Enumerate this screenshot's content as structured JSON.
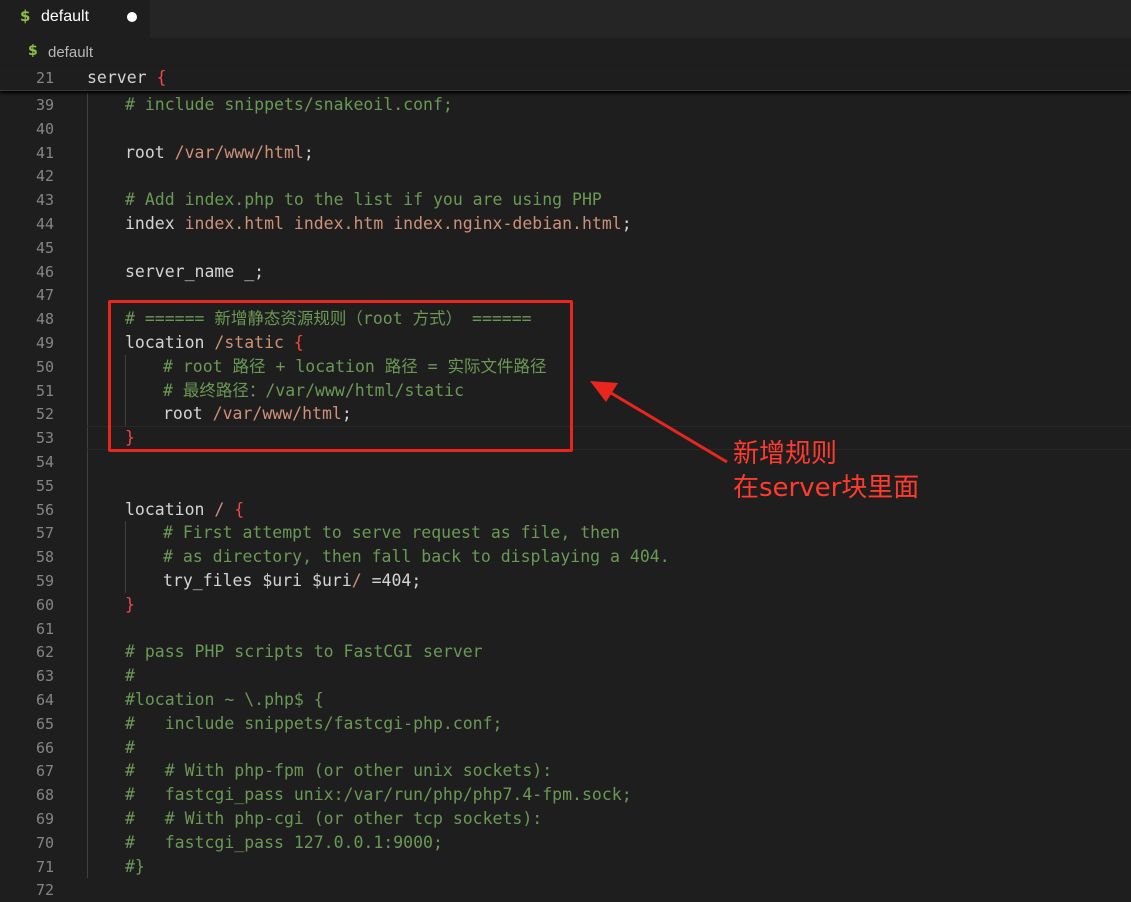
{
  "tab": {
    "icon": "dollar-file-icon",
    "label": "default",
    "dirty": true
  },
  "breadcrumb": {
    "icon": "dollar-file-icon",
    "label": "default"
  },
  "sticky_line": {
    "number": "21",
    "code": "server {"
  },
  "lines": [
    {
      "n": "39",
      "indent": 1,
      "parts": [
        [
          "cm",
          "# include snippets/snakeoil.conf;"
        ]
      ]
    },
    {
      "n": "40",
      "indent": 1,
      "parts": []
    },
    {
      "n": "41",
      "indent": 1,
      "parts": [
        [
          "plain",
          "root "
        ],
        [
          "vs",
          "/var/www/html"
        ],
        [
          "plain",
          ";"
        ]
      ]
    },
    {
      "n": "42",
      "indent": 1,
      "parts": []
    },
    {
      "n": "43",
      "indent": 1,
      "parts": [
        [
          "cm",
          "# Add index.php to the list if you are using PHP"
        ]
      ]
    },
    {
      "n": "44",
      "indent": 1,
      "parts": [
        [
          "plain",
          "index "
        ],
        [
          "vs",
          "index.html index.htm index.nginx-debian.html"
        ],
        [
          "plain",
          ";"
        ]
      ]
    },
    {
      "n": "45",
      "indent": 1,
      "parts": []
    },
    {
      "n": "46",
      "indent": 1,
      "parts": [
        [
          "plain",
          "server_name _;"
        ]
      ]
    },
    {
      "n": "47",
      "indent": 1,
      "parts": []
    },
    {
      "n": "48",
      "indent": 1,
      "parts": [
        [
          "cm",
          "# ====== 新增静态资源规则（root 方式） ======"
        ]
      ]
    },
    {
      "n": "49",
      "indent": 1,
      "parts": [
        [
          "plain",
          "location "
        ],
        [
          "vs",
          "/static "
        ],
        [
          "br",
          "{"
        ]
      ]
    },
    {
      "n": "50",
      "indent": 2,
      "parts": [
        [
          "cm",
          "# root 路径 + location 路径 = 实际文件路径"
        ]
      ]
    },
    {
      "n": "51",
      "indent": 2,
      "parts": [
        [
          "cm",
          "# 最终路径：/var/www/html/static"
        ]
      ]
    },
    {
      "n": "52",
      "indent": 2,
      "parts": [
        [
          "plain",
          "root "
        ],
        [
          "vs",
          "/var/www/html"
        ],
        [
          "plain",
          ";"
        ]
      ]
    },
    {
      "n": "53",
      "indent": 1,
      "parts": [
        [
          "br",
          "}"
        ]
      ]
    },
    {
      "n": "54",
      "indent": 1,
      "parts": []
    },
    {
      "n": "55",
      "indent": 1,
      "parts": []
    },
    {
      "n": "56",
      "indent": 1,
      "parts": [
        [
          "plain",
          "location "
        ],
        [
          "vs",
          "/ "
        ],
        [
          "br",
          "{"
        ]
      ]
    },
    {
      "n": "57",
      "indent": 2,
      "parts": [
        [
          "cm",
          "# First attempt to serve request as file, then"
        ]
      ]
    },
    {
      "n": "58",
      "indent": 2,
      "parts": [
        [
          "cm",
          "# as directory, then fall back to displaying a 404."
        ]
      ]
    },
    {
      "n": "59",
      "indent": 2,
      "parts": [
        [
          "plain",
          "try_files "
        ],
        [
          "plain",
          "$uri $uri"
        ],
        [
          "vs",
          "/ "
        ],
        [
          "plain",
          "=404;"
        ]
      ]
    },
    {
      "n": "60",
      "indent": 1,
      "parts": [
        [
          "br",
          "}"
        ]
      ]
    },
    {
      "n": "61",
      "indent": 1,
      "parts": []
    },
    {
      "n": "62",
      "indent": 1,
      "parts": [
        [
          "cm",
          "# pass PHP scripts to FastCGI server"
        ]
      ]
    },
    {
      "n": "63",
      "indent": 1,
      "parts": [
        [
          "cm",
          "#"
        ]
      ]
    },
    {
      "n": "64",
      "indent": 1,
      "parts": [
        [
          "cm",
          "#location ~ \\.php$ {"
        ]
      ]
    },
    {
      "n": "65",
      "indent": 1,
      "parts": [
        [
          "cm",
          "#   include snippets/fastcgi-php.conf;"
        ]
      ]
    },
    {
      "n": "66",
      "indent": 1,
      "parts": [
        [
          "cm",
          "#"
        ]
      ]
    },
    {
      "n": "67",
      "indent": 1,
      "parts": [
        [
          "cm",
          "#   # With php-fpm (or other unix sockets):"
        ]
      ]
    },
    {
      "n": "68",
      "indent": 1,
      "parts": [
        [
          "cm",
          "#   fastcgi_pass unix:/var/run/php/php7.4-fpm.sock;"
        ]
      ]
    },
    {
      "n": "69",
      "indent": 1,
      "parts": [
        [
          "cm",
          "#   # With php-cgi (or other tcp sockets):"
        ]
      ]
    },
    {
      "n": "70",
      "indent": 1,
      "parts": [
        [
          "cm",
          "#   fastcgi_pass 127.0.0.1:9000;"
        ]
      ]
    },
    {
      "n": "71",
      "indent": 1,
      "parts": [
        [
          "cm",
          "#}"
        ]
      ]
    },
    {
      "n": "72",
      "indent": 0,
      "parts": []
    }
  ],
  "annotation": {
    "line1": "新增规则",
    "line2": "在server块里面"
  },
  "colors": {
    "background": "#1e1e1e",
    "comment": "#6a9955",
    "string": "#ce9178",
    "annotation_red": "#ff3b2f"
  }
}
